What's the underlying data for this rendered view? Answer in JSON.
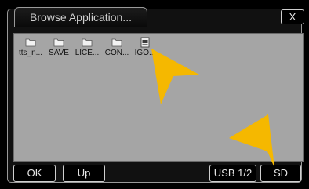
{
  "header": {
    "title": "Browse Application...",
    "close_label": "X"
  },
  "files": [
    {
      "label": "tts_n...",
      "icon": "folder-icon"
    },
    {
      "label": "SAVE",
      "icon": "folder-icon"
    },
    {
      "label": "LICE...",
      "icon": "folder-icon"
    },
    {
      "label": "CON...",
      "icon": "folder-icon"
    },
    {
      "label": "IGO...",
      "icon": "igo-app-icon"
    }
  ],
  "toolbar": {
    "ok_label": "OK",
    "up_label": "Up",
    "usb_label": "USB 1/2",
    "sd_label": "SD"
  },
  "colors": {
    "background": "#000000",
    "file_area": "#a5a5a5",
    "border": "#cfcfcf",
    "pointer": "#f5b800"
  }
}
